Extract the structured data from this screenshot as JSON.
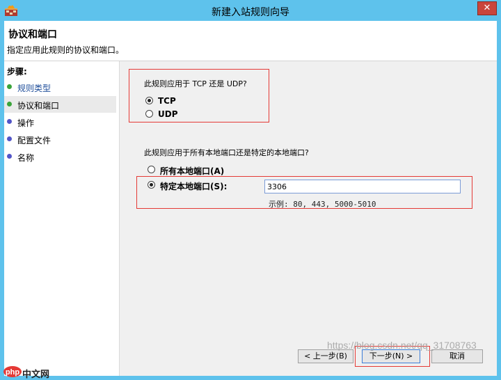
{
  "window": {
    "title": "新建入站规则向导",
    "close_glyph": "✕"
  },
  "header": {
    "title": "协议和端口",
    "subtitle": "指定应用此规则的协议和端口。"
  },
  "steps": {
    "label": "步骤:",
    "items": [
      {
        "label": "规则类型",
        "state": "done"
      },
      {
        "label": "协议和端口",
        "state": "current"
      },
      {
        "label": "操作",
        "state": "pending"
      },
      {
        "label": "配置文件",
        "state": "pending"
      },
      {
        "label": "名称",
        "state": "pending"
      }
    ]
  },
  "protocol": {
    "question": "此规则应用于 TCP 还是 UDP?",
    "options": [
      {
        "label": "TCP",
        "selected": true
      },
      {
        "label": "UDP",
        "selected": false
      }
    ]
  },
  "ports": {
    "question": "此规则应用于所有本地端口还是特定的本地端口?",
    "all_label": "所有本地端口(A)",
    "specific_label": "特定本地端口(S):",
    "specific_selected": true,
    "value": "3306",
    "example": "示例: 80, 443, 5000-5010"
  },
  "buttons": {
    "back": "< 上一步(B)",
    "next": "下一步(N) >",
    "cancel": "取消"
  },
  "watermark": "https://blog.csdn.net/qq_31708763",
  "logo": {
    "text": "中文网",
    "mark": "php"
  },
  "colors": {
    "title_bar": "#5ec2ec",
    "highlight": "#e53935",
    "done_dot": "#3aa43a",
    "pending_dot": "#5255c8"
  }
}
